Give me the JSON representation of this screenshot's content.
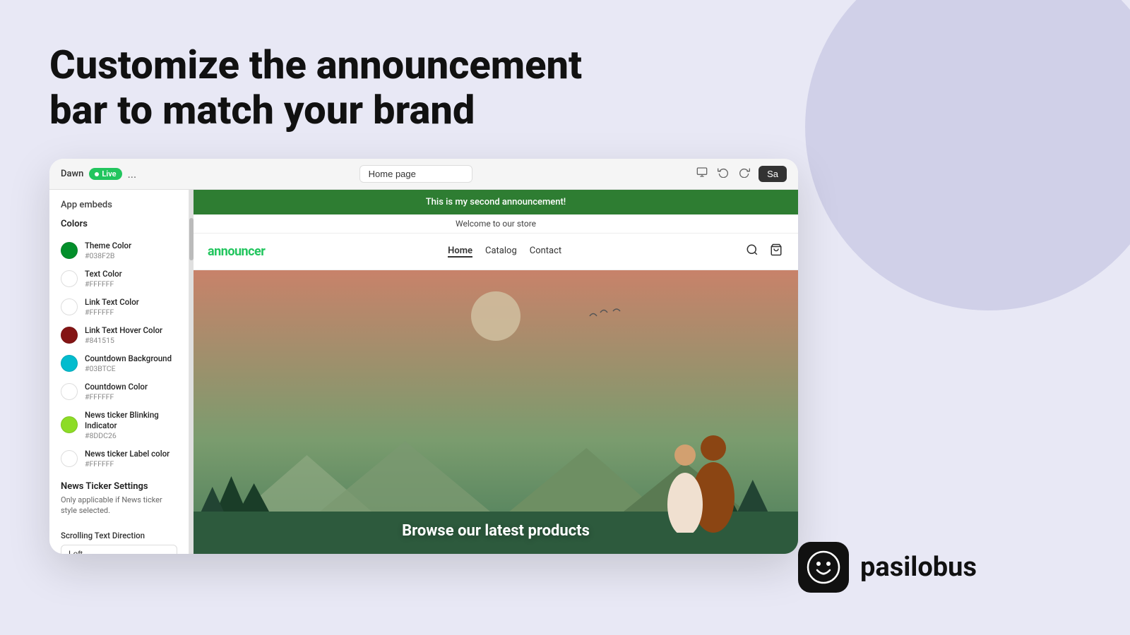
{
  "page": {
    "background_color": "#e8e8f5",
    "headline_line1": "Customize the announcement",
    "headline_line2": "bar to match your brand"
  },
  "logo": {
    "icon_alt": "pasilobus smiley icon",
    "brand_name": "pasilobus"
  },
  "browser": {
    "topbar": {
      "dawn_label": "Dawn",
      "live_badge": "Live",
      "more_button": "...",
      "page_selector_value": "Home page",
      "save_button": "Sa"
    },
    "settings_panel": {
      "app_embeds_label": "App embeds",
      "colors_section_label": "Colors",
      "color_items": [
        {
          "name": "Theme Color",
          "hex": "#038F2B",
          "css_color": "#038F2B"
        },
        {
          "name": "Text Color",
          "hex": "#FFFFFF",
          "css_color": "#FFFFFF"
        },
        {
          "name": "Link Text Color",
          "hex": "#FFFFFF",
          "css_color": "#FFFFFF"
        },
        {
          "name": "Link Text Hover Color",
          "hex": "#841515",
          "css_color": "#841515"
        },
        {
          "name": "Countdown Background",
          "hex": "#03BTCE",
          "css_color": "#03BCCE"
        },
        {
          "name": "Countdown Color",
          "hex": "#FFFFFF",
          "css_color": "#FFFFFF"
        },
        {
          "name": "News ticker Blinking Indicator",
          "hex": "#8DDC26",
          "css_color": "#8DDC26"
        },
        {
          "name": "News ticker Label color",
          "hex": "#FFFFFF",
          "css_color": "#FFFFFF"
        }
      ],
      "news_ticker_section_title": "News Ticker Settings",
      "news_ticker_desc": "Only applicable if News ticker style selected.",
      "scrolling_text_direction_label": "Scrolling Text Direction",
      "scrolling_select_value": "Left"
    },
    "store_preview": {
      "announcement_text": "This is my second announcement!",
      "sub_bar_text": "Welcome to our store",
      "store_logo": "announcer",
      "nav_links": [
        "Home",
        "Catalog",
        "Contact"
      ],
      "hero_text": "Browse our latest products"
    }
  }
}
